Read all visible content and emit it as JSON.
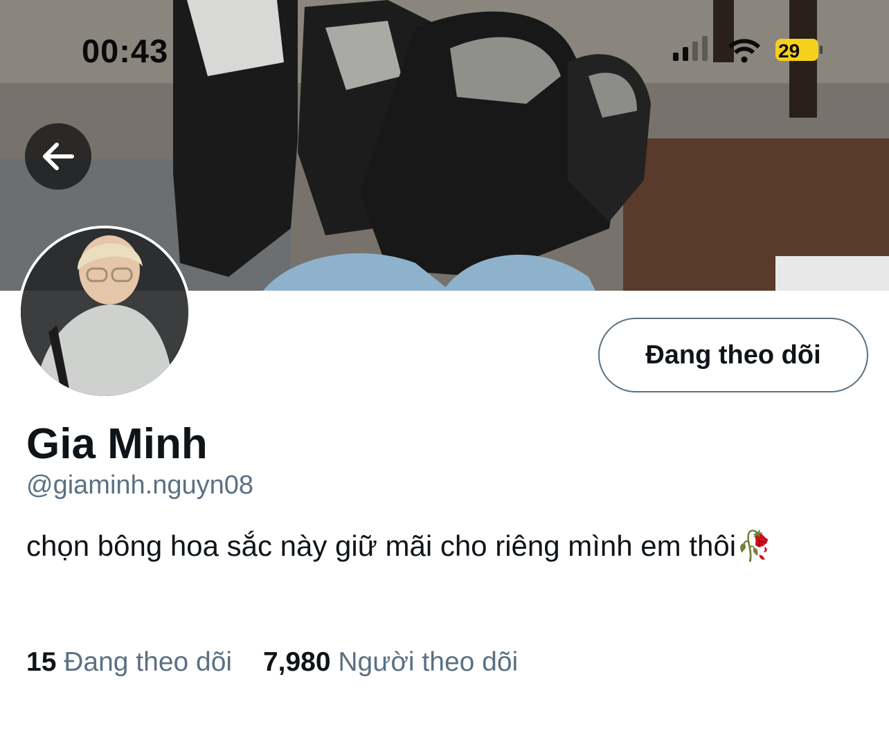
{
  "status_bar": {
    "time": "00:43",
    "battery": "29"
  },
  "profile": {
    "display_name": "Gia Minh",
    "handle": "@giaminh.nguyn08",
    "bio": "chọn bông hoa sắc này giữ mãi cho riêng mình em thôi🥀",
    "follow_button_label": "Đang theo dõi",
    "following_count": "15",
    "following_label": "Đang theo dõi",
    "followers_count": "7,980",
    "followers_label": "Người theo dõi"
  },
  "icons": {
    "back": "arrow-left-icon",
    "signal": "cellular-signal-icon",
    "wifi": "wifi-icon",
    "battery": "battery-charging-icon"
  },
  "colors": {
    "secondary_text": "#5b7083",
    "button_border": "#5a6f80",
    "battery": "#f5d01c"
  }
}
